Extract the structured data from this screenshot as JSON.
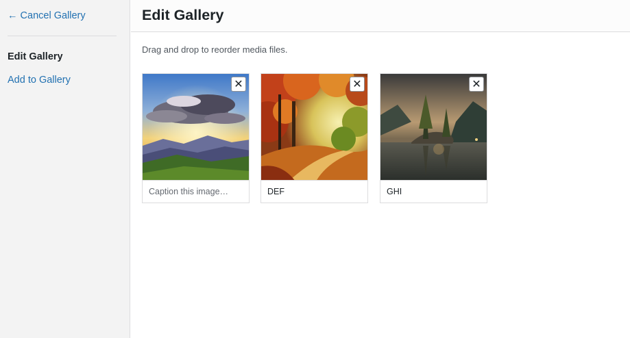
{
  "sidebar": {
    "cancel_label": "← Cancel Gallery",
    "items": [
      {
        "label": "Edit Gallery",
        "active": true
      },
      {
        "label": "Add to Gallery",
        "active": false
      }
    ]
  },
  "header": {
    "title": "Edit Gallery"
  },
  "main": {
    "instructions": "Drag and drop to reorder media files.",
    "gallery": [
      {
        "image": "sunset-mountains",
        "caption": "",
        "caption_placeholder": "Caption this image…",
        "remove_label": "✕"
      },
      {
        "image": "autumn-forest-path",
        "caption": "DEF",
        "caption_placeholder": "Caption this image…",
        "remove_label": "✕"
      },
      {
        "image": "lake-island-trees",
        "caption": "GHI",
        "caption_placeholder": "Caption this image…",
        "remove_label": "✕"
      }
    ]
  },
  "colors": {
    "link": "#2271b1",
    "sidebar_bg": "#f3f3f3",
    "text": "#1d2327"
  }
}
